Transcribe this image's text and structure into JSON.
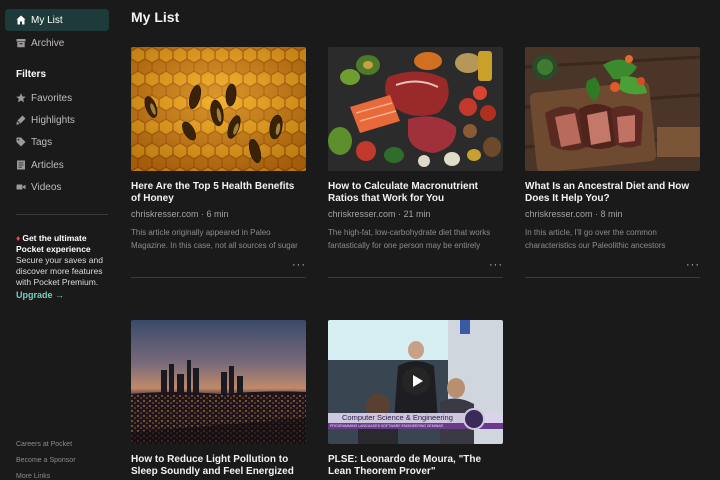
{
  "sidebar": {
    "my_list": "My List",
    "archive": "Archive",
    "filters_title": "Filters",
    "favorites": "Favorites",
    "highlights": "Highlights",
    "tags": "Tags",
    "articles": "Articles",
    "videos": "Videos",
    "promo": {
      "title": "Get the ultimate Pocket experience",
      "body": "Secure your saves and discover more features with Pocket Premium.",
      "upgrade": "Upgrade →"
    },
    "footer": {
      "careers": "Careers at Pocket",
      "sponsor": "Become a Sponsor",
      "more": "More Links"
    }
  },
  "main": {
    "title": "My List",
    "cards": [
      {
        "title": "Here Are the Top 5 Health Benefits of Honey",
        "meta": "chriskresser.com · 6 min",
        "excerpt": "This article originally appeared in Paleo Magazine. In this case, not all sources of sugar"
      },
      {
        "title": "How to Calculate Macronutrient Ratios that Work for You",
        "meta": "chriskresser.com · 21 min",
        "excerpt": "The high-fat, low-carbohydrate diet that works fantastically for one person may be entirely"
      },
      {
        "title": "What Is an Ancestral Diet and How Does It Help You?",
        "meta": "chriskresser.com · 8 min",
        "excerpt": "In this article, I'll go over the common characteristics our Paleolithic ancestors"
      },
      {
        "title": "How to Reduce Light Pollution to Sleep Soundly and Feel Energized"
      },
      {
        "title": "PLSE: Leonardo de Moura, \"The Lean Theorem Prover\"",
        "video_banner": "Computer Science & Engineering",
        "video_subbanner": "PROGRAMMING LANGUAGES SOFTWARE ENGINEERING SEMINAR"
      }
    ],
    "more_label": "···"
  },
  "colors": {
    "background": "#1a1a1a",
    "active_nav": "#1f3a3a",
    "accent": "#6fd0c2"
  }
}
